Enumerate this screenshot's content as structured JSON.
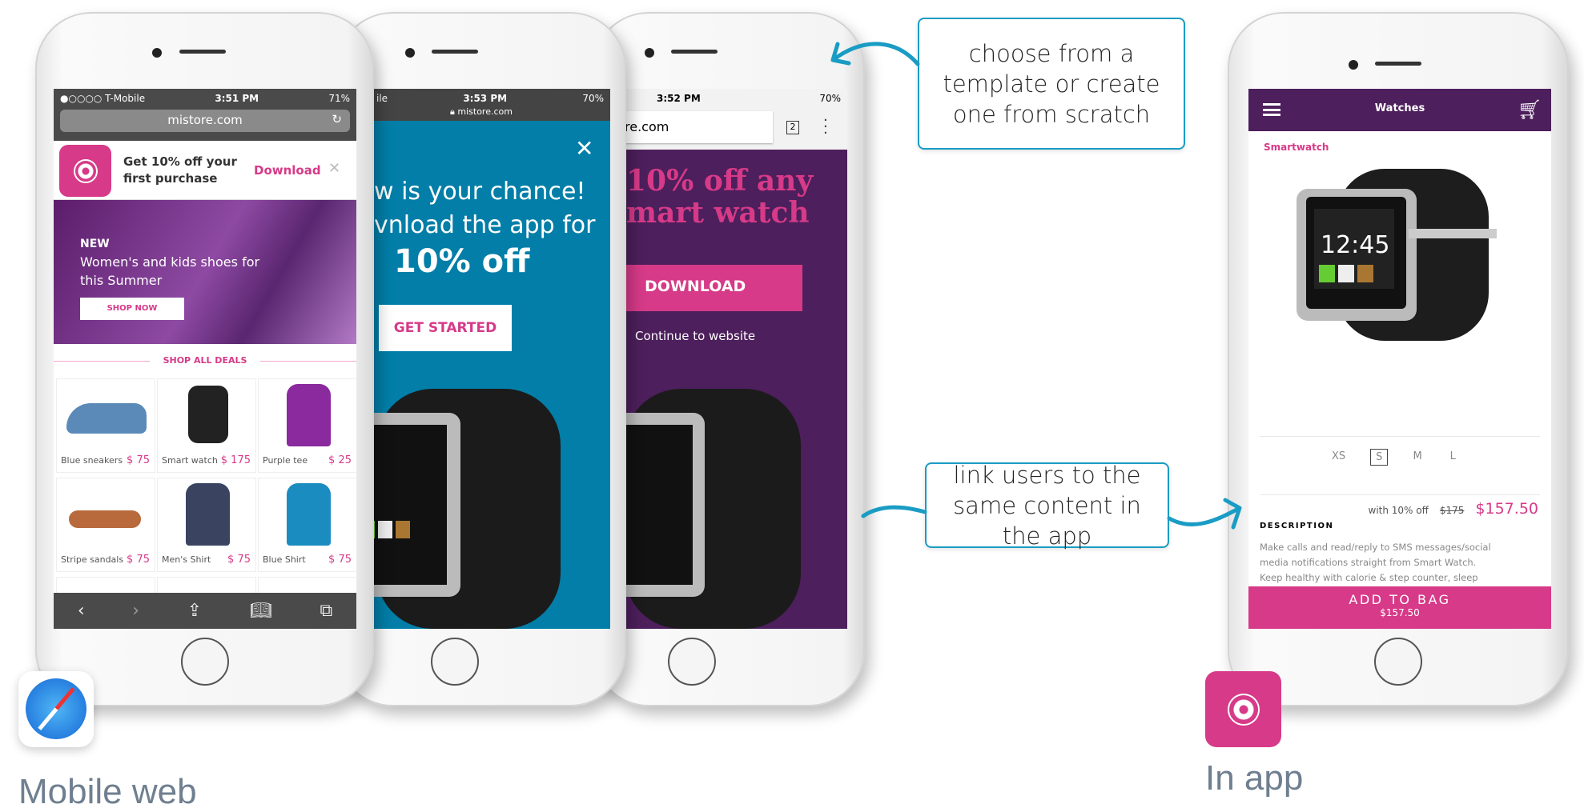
{
  "colors": {
    "accent_pink": "#d63a88",
    "popup_blue": "#027ea8",
    "app_purple": "#4d1f5c",
    "callout_blue": "#1a9cc4"
  },
  "phone1": {
    "status": {
      "carrier": "●○○○○ T-Mobile",
      "time": "3:51 PM",
      "battery": "71%"
    },
    "url": "mistore.com",
    "banner": {
      "title": "Get 10% off your first purchase",
      "cta": "Download"
    },
    "hero": {
      "tag": "NEW",
      "text": "Women's and kids shoes for this Summer",
      "button": "SHOP NOW"
    },
    "section": "SHOP ALL DEALS",
    "products": [
      {
        "name": "Blue sneakers",
        "price": "$ 75",
        "icon": "sneaker"
      },
      {
        "name": "Smart watch",
        "price": "$ 175",
        "icon": "watch"
      },
      {
        "name": "Purple tee",
        "price": "$ 25",
        "icon": "shirt"
      },
      {
        "name": "Stripe sandals",
        "price": "$ 75",
        "icon": "sandal"
      },
      {
        "name": "Men's Shirt",
        "price": "$ 75",
        "icon": "shirt"
      },
      {
        "name": "Blue Shirt",
        "price": "$ 75",
        "icon": "shirt"
      }
    ]
  },
  "phone2": {
    "status": {
      "carrier": "ile",
      "time": "3:53 PM",
      "battery": "70%"
    },
    "url": "mistore.com",
    "line1": "w is your chance!",
    "line2": "vnload the app for",
    "line3": "10% off",
    "button": "GET STARTED"
  },
  "phone3": {
    "status": {
      "time": "3:52 PM",
      "battery": "70%"
    },
    "url": "re.com",
    "tabs": "2",
    "line1": "10% off any",
    "line2": "mart watch",
    "button": "DOWNLOAD",
    "link": "Continue to website"
  },
  "phone4": {
    "header": "Watches",
    "category": "Smartwatch",
    "sizes": [
      "XS",
      "S",
      "M",
      "L"
    ],
    "selected_size": "S",
    "discount": "with 10% off",
    "old_price": "$175",
    "price": "$157.50",
    "desc_title": "DESCRIPTION",
    "desc_lines": [
      "Make calls and read/reply to SMS messages/social",
      "media notifications straight from Smart Watch.",
      "Keep healthy with calorie & step counter, sleep"
    ],
    "cta": "ADD TO BAG",
    "cta_price": "$157.50"
  },
  "callouts": {
    "top": "choose from a template or create one from scratch",
    "bottom": "link users to the same content in the app"
  },
  "labels": {
    "web": "Mobile web",
    "app": "In app"
  }
}
